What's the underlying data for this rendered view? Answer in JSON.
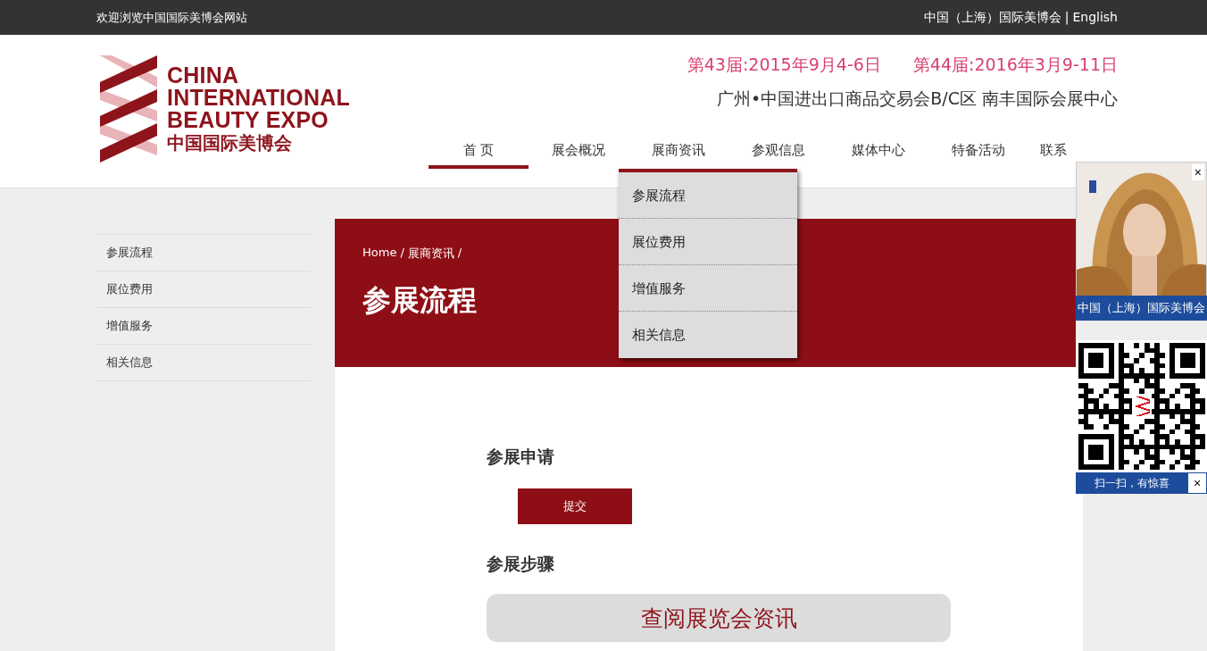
{
  "top_bar": {
    "welcome": "欢迎浏览中国国际美博会网站",
    "links": [
      {
        "label": "中国（上海）国际美博会"
      },
      {
        "label": "English"
      }
    ],
    "separator": "|"
  },
  "logo": {
    "lines": [
      "CHINA",
      "INTERNATIONAL",
      "BEAUTY EXPO"
    ],
    "chinese": "中国国际美博会"
  },
  "header": {
    "dates": [
      "第43届:2015年9月4-6日",
      "第44届:2016年3月9-11日"
    ],
    "venue": "广州•中国进出口商品交易会B/C区 南丰国际会展中心"
  },
  "nav": [
    {
      "label": "首 页",
      "selected": true,
      "expanded": false
    },
    {
      "label": "展会概况",
      "selected": false,
      "expanded": false
    },
    {
      "label": "展商资讯",
      "selected": false,
      "expanded": true
    },
    {
      "label": "参观信息",
      "selected": false,
      "expanded": false
    },
    {
      "label": "媒体中心",
      "selected": false,
      "expanded": false
    },
    {
      "label": "特备活动",
      "selected": false,
      "expanded": false
    },
    {
      "label": "联系",
      "selected": false,
      "expanded": false
    }
  ],
  "dropdown": {
    "items": [
      "参展流程",
      "展位费用",
      "增值服务",
      "相关信息"
    ]
  },
  "sidebar": {
    "items": [
      "参展流程",
      "展位费用",
      "增值服务",
      "相关信息"
    ]
  },
  "banner": {
    "breadcrumb": [
      {
        "label": "Home"
      },
      {
        "label": "展商资讯"
      }
    ],
    "separator": "/",
    "title": "参展流程"
  },
  "content": {
    "sections": [
      {
        "kind": "button",
        "heading": "参展申请",
        "button": "提交"
      },
      {
        "kind": "link_bar",
        "heading": "参展步骤",
        "button": "查阅展览会资讯"
      }
    ]
  },
  "float_ad": {
    "close": "×",
    "caption": "中国（上海）国际美博会",
    "qr_caption": "扫一扫，有惊喜",
    "qr_close": "×"
  }
}
